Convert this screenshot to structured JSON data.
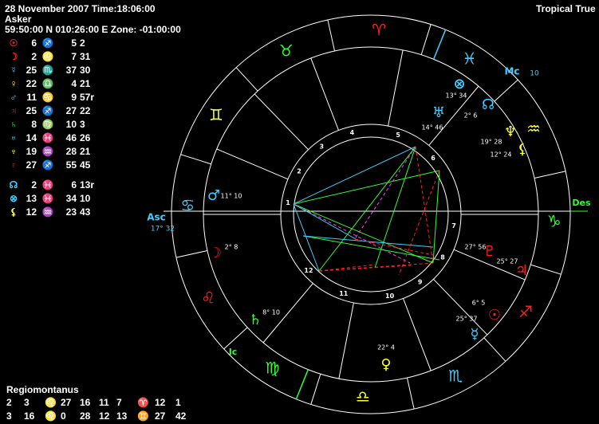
{
  "header": {
    "datetime": "28 November 2007 Time:18:06:00",
    "chart_name": "Asker",
    "location": "59:50:00 N 010:26:00 E Zone: -01:00:00",
    "mode": "Tropical True"
  },
  "planets": [
    {
      "name": "sun",
      "symbol": "☉",
      "deg": "6",
      "sign_glyph": "♐",
      "min": "5",
      "sec": "2",
      "color": "#ff2020",
      "sign_color": "#ff2020"
    },
    {
      "name": "moon",
      "symbol": "☽",
      "deg": "2",
      "sign_glyph": "♌",
      "min": "7",
      "sec": "31",
      "color": "#ff2020",
      "sign_color": "#ff2020"
    },
    {
      "name": "mercury",
      "symbol": "☿",
      "deg": "25",
      "sign_glyph": "♏",
      "min": "37",
      "sec": "30",
      "color": "#40d0ff",
      "sign_color": "#40d0ff"
    },
    {
      "name": "venus",
      "symbol": "♀",
      "deg": "22",
      "sign_glyph": "♎",
      "min": "4",
      "sec": "21",
      "color": "#ffff30",
      "sign_color": "#ffff30"
    },
    {
      "name": "mars",
      "symbol": "♂",
      "deg": "11",
      "sign_glyph": "♋",
      "min": "9",
      "sec": "57r",
      "color": "#40d0ff",
      "sign_color": "#40d0ff"
    },
    {
      "name": "jupiter",
      "symbol": "♃",
      "deg": "25",
      "sign_glyph": "♐",
      "min": "27",
      "sec": "22",
      "color": "#ff2020",
      "sign_color": "#ff2020"
    },
    {
      "name": "saturn",
      "symbol": "♄",
      "deg": "8",
      "sign_glyph": "♍",
      "min": "10",
      "sec": "3",
      "color": "#30ff30",
      "sign_color": "#30ff30"
    },
    {
      "name": "uranus",
      "symbol": "♅",
      "deg": "14",
      "sign_glyph": "♓",
      "min": "46",
      "sec": "26",
      "color": "#40d0ff",
      "sign_color": "#40d0ff"
    },
    {
      "name": "neptune",
      "symbol": "♆",
      "deg": "19",
      "sign_glyph": "♒",
      "min": "28",
      "sec": "21",
      "color": "#ffff30",
      "sign_color": "#ffff30"
    },
    {
      "name": "pluto",
      "symbol": "♇",
      "deg": "27",
      "sign_glyph": "♐",
      "min": "55",
      "sec": "45",
      "color": "#ff2020",
      "sign_color": "#ff2020"
    },
    {
      "name": "gap"
    },
    {
      "name": "node",
      "symbol": "☊",
      "deg": "2",
      "sign_glyph": "♓",
      "min": "6",
      "sec": "13r",
      "color": "#40d0ff",
      "sign_color": "#40d0ff"
    },
    {
      "name": "fortune",
      "symbol": "⊗",
      "deg": "13",
      "sign_glyph": "♓",
      "min": "34",
      "sec": "10",
      "color": "#40d0ff",
      "sign_color": "#40d0ff"
    },
    {
      "name": "lilith",
      "symbol": "⚸",
      "deg": "12",
      "sign_glyph": "♒",
      "min": "23",
      "sec": "43",
      "color": "#ffff30",
      "sign_color": "#ffff30"
    }
  ],
  "house_system": {
    "label": "Regiomontanus",
    "rows": [
      [
        "2",
        "3",
        "♌",
        "27",
        "16",
        "11",
        "7",
        "♈",
        "12",
        "1"
      ],
      [
        "3",
        "16",
        "♌",
        "0",
        "28",
        "12",
        "13",
        "♊",
        "27",
        "42"
      ]
    ],
    "sign_colors": [
      [
        "#ff2020",
        "#ff2020"
      ],
      [
        "#ff2020",
        "#ffff30"
      ]
    ]
  },
  "wheel": {
    "angles": {
      "asc": "Asc",
      "asc_deg": "17° 32",
      "des": "Des",
      "mc": "Mc",
      "mc_deg": "10",
      "ic": "Ic"
    },
    "zodiac": [
      {
        "glyph": "♈",
        "color": "#ff2020"
      },
      {
        "glyph": "♉",
        "color": "#30ff30"
      },
      {
        "glyph": "♊",
        "color": "#ffff30"
      },
      {
        "glyph": "♋",
        "color": "#40d0ff"
      },
      {
        "glyph": "♌",
        "color": "#ff2020"
      },
      {
        "glyph": "♍",
        "color": "#30ff30"
      },
      {
        "glyph": "♎",
        "color": "#ffff30"
      },
      {
        "glyph": "♏",
        "color": "#40d0ff"
      },
      {
        "glyph": "♐",
        "color": "#ff2020"
      },
      {
        "glyph": "♑",
        "color": "#30ff30"
      },
      {
        "glyph": "♒",
        "color": "#ffff30"
      },
      {
        "glyph": "♓",
        "color": "#40d0ff"
      }
    ],
    "house_numbers": [
      "1",
      "2",
      "3",
      "4",
      "5",
      "6",
      "7",
      "8",
      "9",
      "10",
      "11",
      "12"
    ],
    "planet_labels": [
      {
        "glyph": "♂",
        "deg": "11",
        "min": "10",
        "color": "#40d0ff"
      },
      {
        "glyph": "☽",
        "deg": "2",
        "min": "8",
        "color": "#ff2020"
      },
      {
        "glyph": "♄",
        "deg": "8",
        "min": "10",
        "color": "#30ff30"
      },
      {
        "glyph": "♀",
        "deg": "22",
        "min": "4",
        "color": "#ffff30"
      },
      {
        "glyph": "☿",
        "deg": "25",
        "min": "37",
        "color": "#40d0ff"
      },
      {
        "glyph": "☉",
        "deg": "6",
        "min": "5",
        "color": "#ff2020"
      },
      {
        "glyph": "♃",
        "deg": "25",
        "min": "27",
        "color": "#ff2020"
      },
      {
        "glyph": "♇",
        "deg": "27",
        "min": "56",
        "color": "#ff2020"
      },
      {
        "glyph": "♆",
        "deg": "19",
        "min": "28",
        "color": "#ffff30"
      },
      {
        "glyph": "⚸",
        "deg": "12",
        "min": "24",
        "color": "#ffff30"
      },
      {
        "glyph": "☊",
        "deg": "2",
        "min": "6",
        "color": "#40d0ff"
      },
      {
        "glyph": "⊗",
        "deg": "13",
        "min": "34",
        "color": "#40d0ff"
      },
      {
        "glyph": "♅",
        "deg": "14",
        "min": "46",
        "color": "#40d0ff"
      }
    ]
  }
}
